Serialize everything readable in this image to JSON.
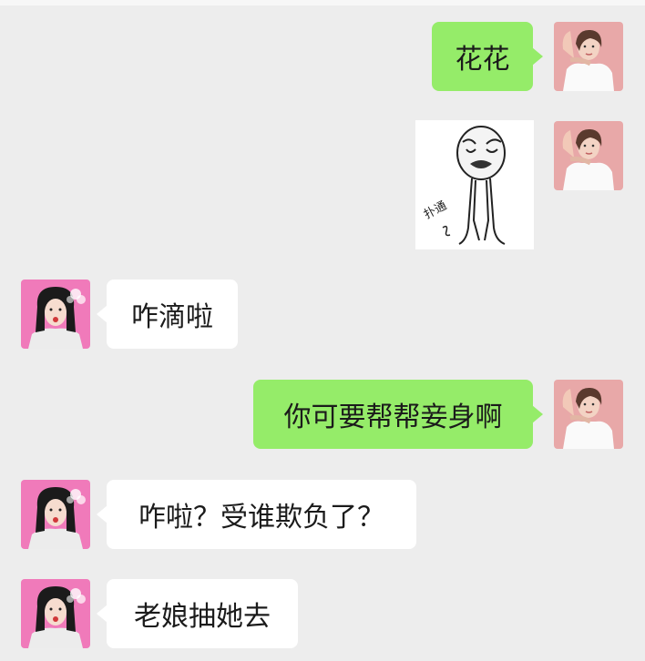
{
  "messages": [
    {
      "side": "out",
      "type": "text",
      "text": "花花"
    },
    {
      "side": "out",
      "type": "sticker",
      "sticker_icon": "crying-meme-face-sticker",
      "caption": "扑通"
    },
    {
      "side": "in",
      "type": "text",
      "text": "咋滴啦"
    },
    {
      "side": "out",
      "type": "text",
      "text": "你可要帮帮妾身啊"
    },
    {
      "side": "in",
      "type": "text",
      "text": "咋啦？受谁欺负了？"
    },
    {
      "side": "in",
      "type": "text",
      "text": "老娘抽她去"
    }
  ],
  "colors": {
    "background": "#ededed",
    "outgoing_bubble": "#95ec69",
    "incoming_bubble": "#ffffff",
    "sender_avatar_bg": "#e8a8a8",
    "receiver_avatar_bg": "#f07aba"
  },
  "avatars": {
    "sender_icon": "woman-raising-arm-avatar",
    "receiver_icon": "woman-smoking-avatar"
  }
}
